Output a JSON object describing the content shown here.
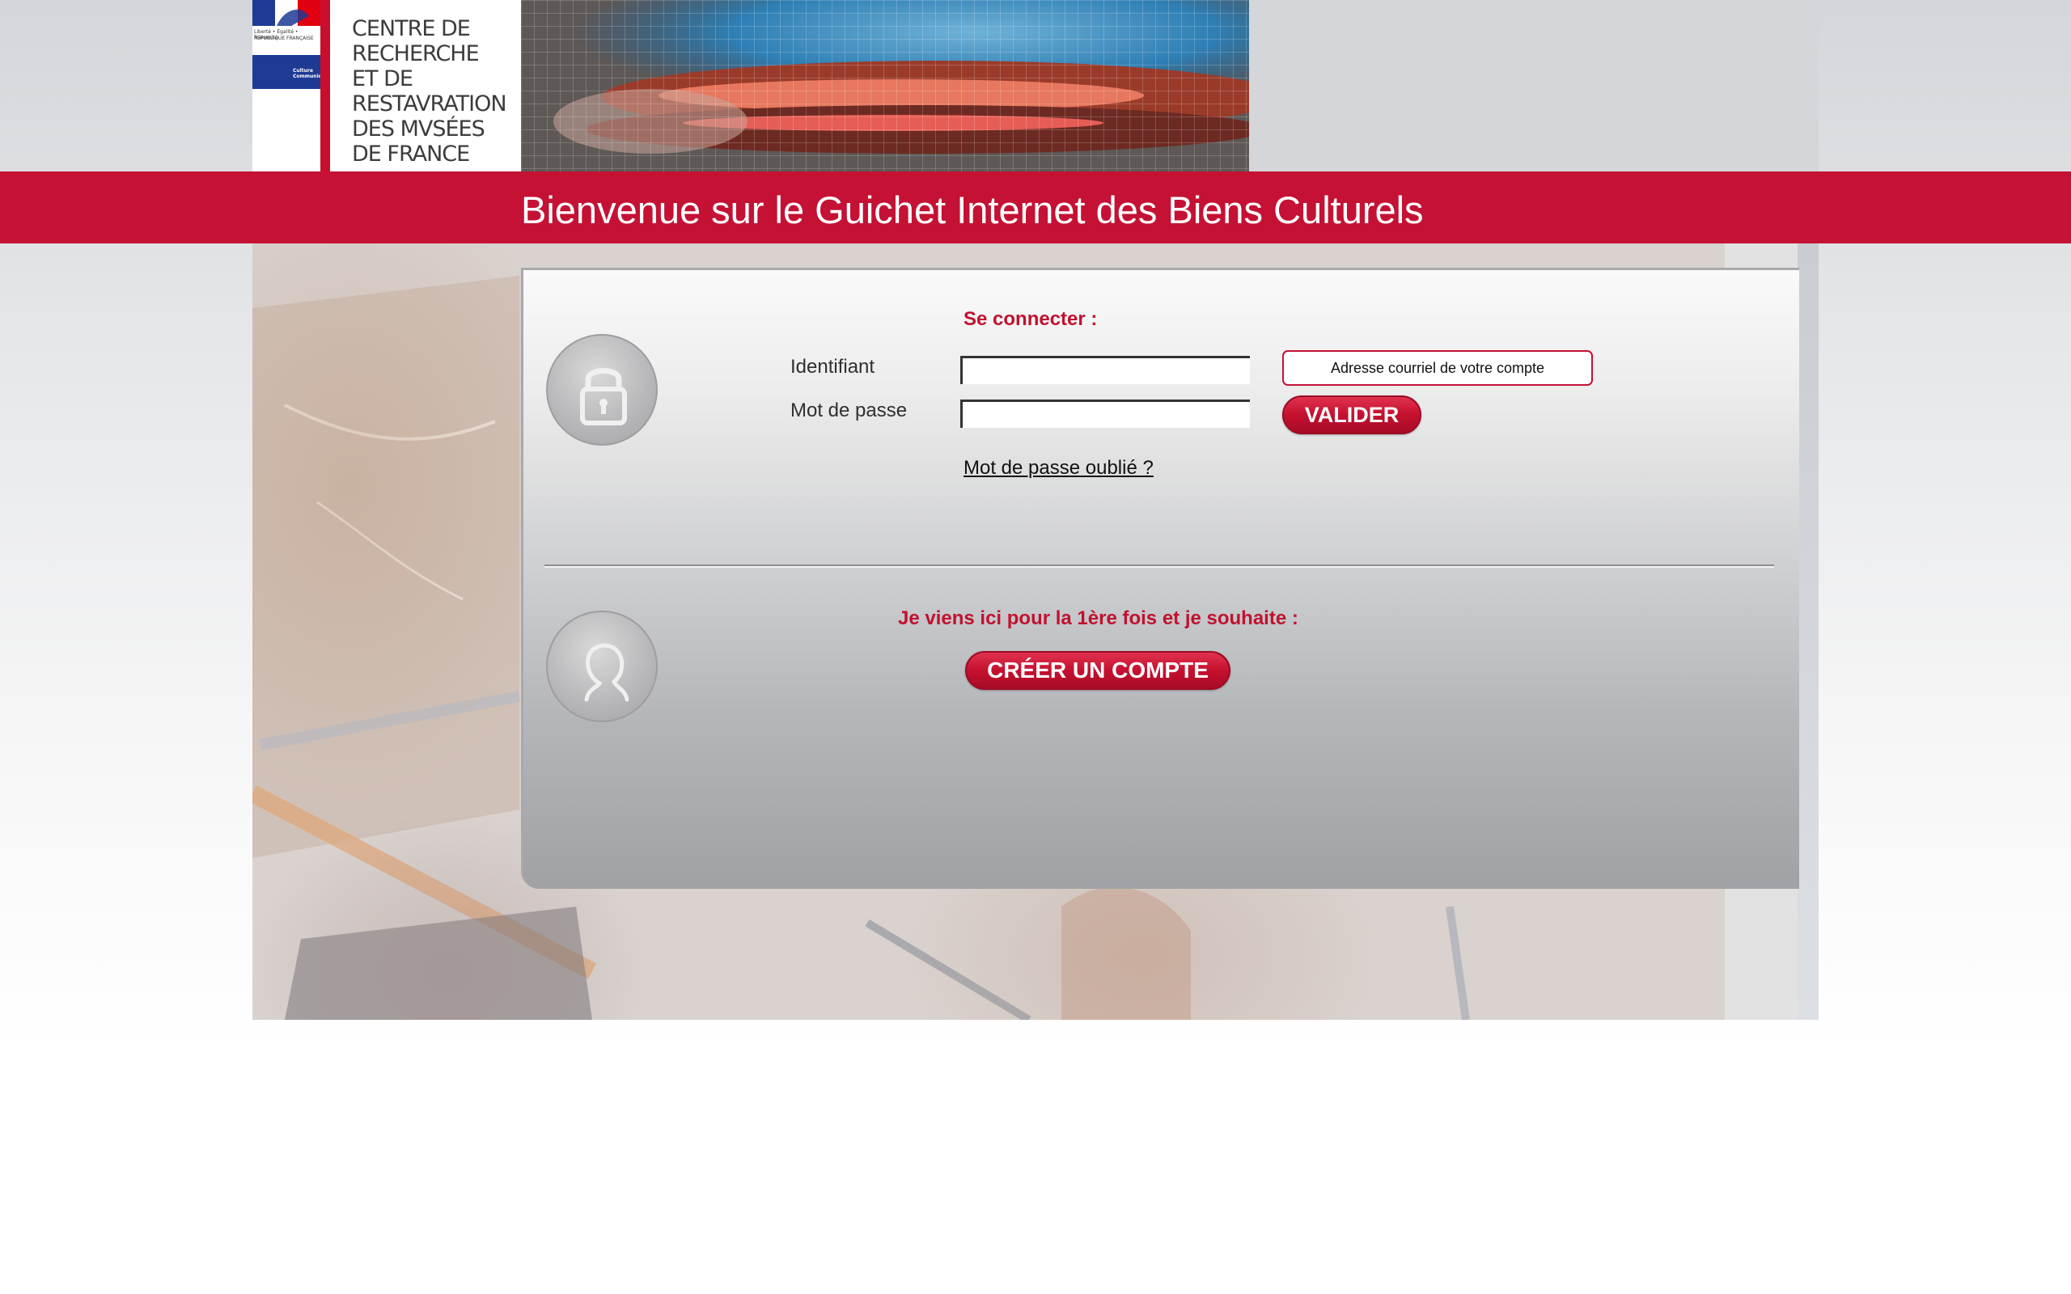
{
  "header": {
    "logo_text": "CENTRE DE\nRECHERCHE\nET DE\nRESTAVRATION\nDES MVSÉES\nDE FRANCE",
    "logo_motto": "Liberté • Égalité • Fraternité",
    "logo_republic": "RÉPUBLIQUE FRANÇAISE",
    "logo_ministry": "Culture\nCommunication",
    "title": "Bienvenue sur le Guichet Internet des Biens Culturels"
  },
  "login": {
    "heading": "Se connecter :",
    "identifiant_label": "Identifiant",
    "identifiant_value": "",
    "password_label": "Mot de passe",
    "password_value": "",
    "email_hint": "Adresse courriel de votre compte",
    "submit_label": "VALIDER",
    "forgot_link": "Mot de passe oublié ?"
  },
  "signup": {
    "heading": "Je viens ici pour la 1ère fois et je souhaite :",
    "create_label": "CRÉER UN COMPTE"
  },
  "icons": {
    "login": "lock-icon",
    "signup": "user-icon"
  },
  "colors": {
    "brand_red": "#c41134",
    "heading_red": "#c0122f"
  }
}
